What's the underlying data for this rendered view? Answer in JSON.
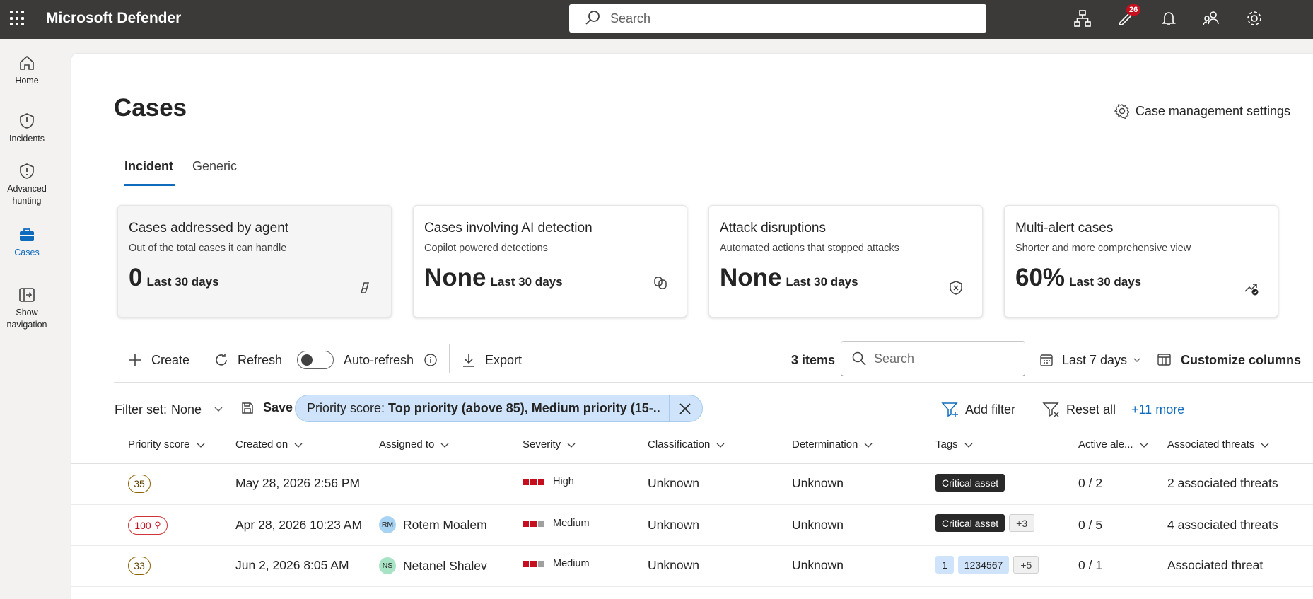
{
  "app": {
    "title": "Microsoft Defender",
    "search_placeholder": "Search",
    "notification_count": "26"
  },
  "nav": {
    "items": [
      {
        "label": "Home",
        "icon": "home-icon"
      },
      {
        "label": "Incidents",
        "icon": "shield-icon"
      },
      {
        "label": "Advanced hunting",
        "icon": "shield-icon"
      },
      {
        "label": "Cases",
        "icon": "briefcase-icon"
      },
      {
        "label": "Show navigation",
        "icon": "show-navigation-icon"
      }
    ]
  },
  "page": {
    "title": "Cases",
    "settings_label": "Case management settings"
  },
  "tabs": [
    {
      "label": "Incident"
    },
    {
      "label": "Generic"
    }
  ],
  "cards": [
    {
      "title": "Cases addressed by agent",
      "subtitle": "Out of the total cases it can handle",
      "value": "0",
      "period": "Last 30 days",
      "icon": "agent-icon"
    },
    {
      "title": "Cases involving AI detection",
      "subtitle": "Copilot powered detections",
      "value": "None",
      "period": "Last 30 days",
      "icon": "copilot-icon"
    },
    {
      "title": "Attack disruptions",
      "subtitle": "Automated actions that stopped attacks",
      "value": "None",
      "period": "Last 30 days",
      "icon": "shield-x-icon"
    },
    {
      "title": "Multi-alert cases",
      "subtitle": "Shorter and more comprehensive view",
      "value": "60%",
      "period": "Last 30 days",
      "icon": "trend-check-icon"
    }
  ],
  "toolbar": {
    "create": "Create",
    "refresh": "Refresh",
    "auto_refresh": "Auto-refresh",
    "export": "Export",
    "items_count": "3 items",
    "search_placeholder": "Search",
    "date_range": "Last 7 days",
    "customize": "Customize columns"
  },
  "filters": {
    "set_label": "Filter set:",
    "set_value": "None",
    "save": "Save",
    "pill_key": "Priority score:",
    "pill_value": "Top priority (above 85), Medium priority (15-...",
    "add_filter": "Add filter",
    "reset_all": "Reset all",
    "more": "+11 more"
  },
  "columns": [
    "Priority score",
    "Created on",
    "Assigned to",
    "Severity",
    "Classification",
    "Determination",
    "Tags",
    "Active ale...",
    "Associated threats"
  ],
  "rows": [
    {
      "score": "35",
      "created": "May 28, 2026 2:56 PM",
      "assignee": "",
      "initials": "",
      "severity": "High",
      "classification": "Unknown",
      "determination": "Unknown",
      "tags": [
        "Critical asset"
      ],
      "tag_more": "",
      "active": "0 / 2",
      "threats": "2 associated threats"
    },
    {
      "score": "100",
      "created": "Apr 28, 2026 10:23 AM",
      "assignee": "Rotem Moalem",
      "initials": "RM",
      "severity": "Medium",
      "classification": "Unknown",
      "determination": "Unknown",
      "tags": [
        "Critical asset"
      ],
      "tag_more": "+3",
      "active": "0 / 5",
      "threats": "4 associated threats"
    },
    {
      "score": "33",
      "created": "Jun 2, 2026 8:05 AM",
      "assignee": "Netanel Shalev",
      "initials": "NS",
      "severity": "Medium",
      "classification": "Unknown",
      "determination": "Unknown",
      "tags": [
        "1",
        "1234567"
      ],
      "tag_more": "+5",
      "active": "0 / 1",
      "threats": "Associated threat"
    }
  ],
  "colors": {
    "accent": "#0f6cbd",
    "topbar": "#3b3a39",
    "severity": "#c50f1f",
    "badge": "#c50f1f"
  }
}
